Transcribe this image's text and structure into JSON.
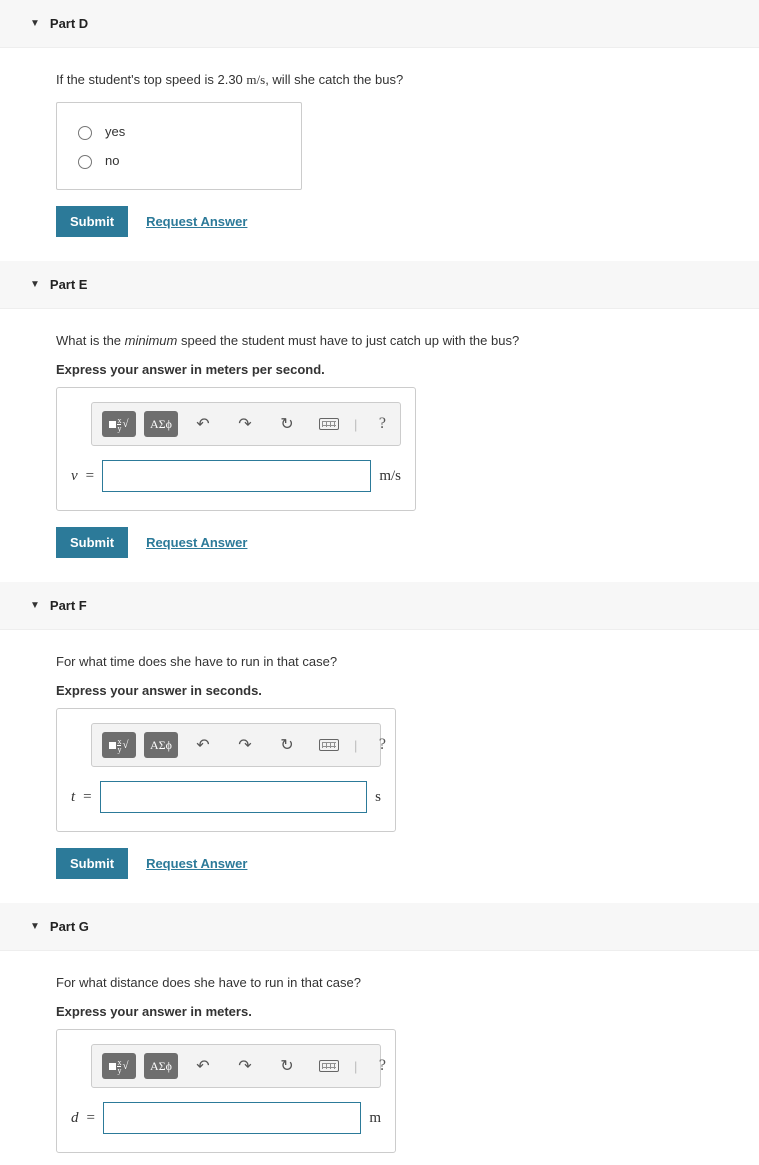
{
  "parts": {
    "D": {
      "title": "Part D",
      "question_html": "If the student's top speed is 2.30 <span class='mf'>m/s</span>, will she catch the bus?",
      "options": [
        "yes",
        "no"
      ],
      "submit": "Submit",
      "request": "Request Answer"
    },
    "E": {
      "title": "Part E",
      "question_html": "What is the <em>minimum</em> speed the student must have to just catch up with the bus?",
      "instruction": "Express your answer in meters per second.",
      "var": "v",
      "unit": "m/s",
      "submit": "Submit",
      "request": "Request Answer"
    },
    "F": {
      "title": "Part F",
      "question_html": "For what time does she have to run in that case?",
      "instruction": "Express your answer in seconds.",
      "var": "t",
      "unit": "s",
      "submit": "Submit",
      "request": "Request Answer"
    },
    "G": {
      "title": "Part G",
      "question_html": "For what distance does she have to run in that case?",
      "instruction": "Express your answer in meters.",
      "var": "d",
      "unit": "m"
    }
  },
  "toolbar": {
    "templates_label": "x√□",
    "greek_label": "ΑΣϕ",
    "undo": "↶",
    "redo": "↷",
    "reset": "↻",
    "keyboard": "⌨",
    "help": "?"
  }
}
